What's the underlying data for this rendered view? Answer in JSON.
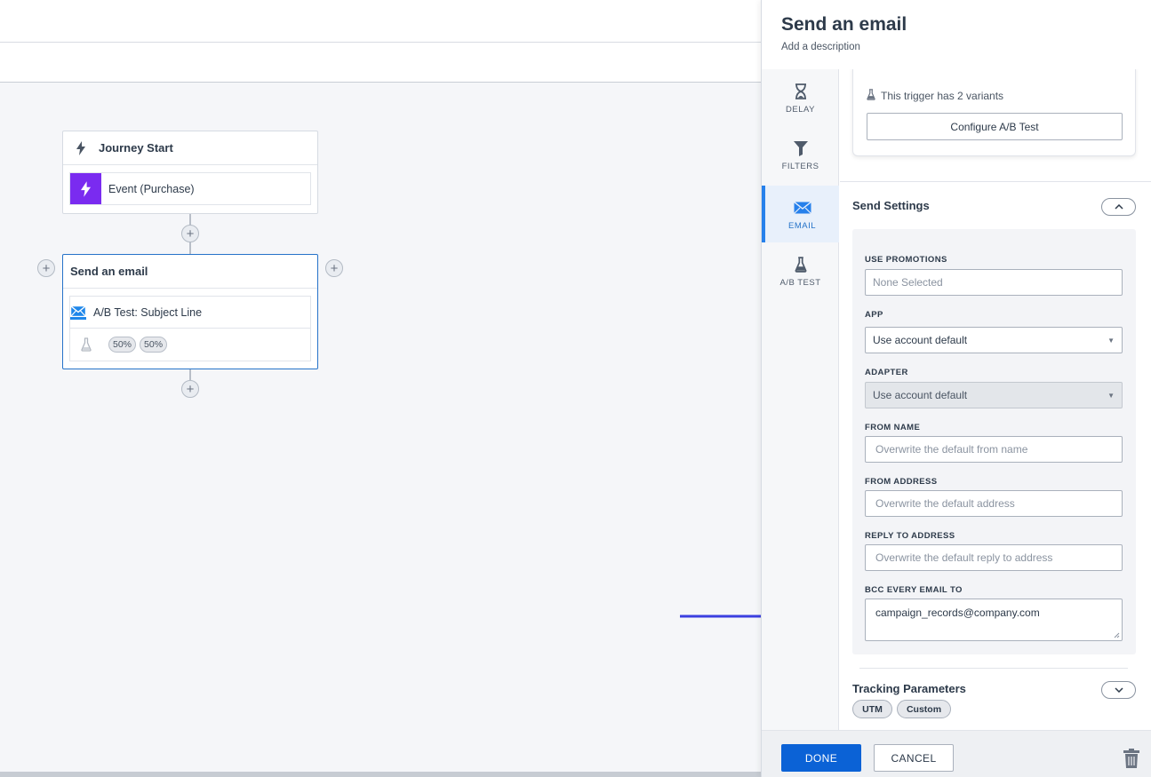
{
  "canvas": {
    "journey_start": {
      "title": "Journey Start",
      "event_label": "Event (Purchase)"
    },
    "email_node": {
      "title": "Send an email",
      "step_label": "A/B Test: Subject Line",
      "splits": [
        "50%",
        "50%"
      ]
    }
  },
  "panel": {
    "title": "Send an email",
    "description": "Add a description",
    "nav": [
      {
        "label": "DELAY",
        "icon": "hourglass-icon"
      },
      {
        "label": "FILTERS",
        "icon": "funnel-icon"
      },
      {
        "label": "EMAIL",
        "icon": "envelope-icon"
      },
      {
        "label": "A/B TEST",
        "icon": "flask-icon"
      }
    ],
    "ab_card": {
      "variants_text": "This trigger has 2 variants",
      "configure_label": "Configure A/B Test"
    },
    "send_settings": {
      "title": "Send Settings",
      "fields": {
        "use_promotions": {
          "label": "USE PROMOTIONS",
          "placeholder": "None Selected"
        },
        "app": {
          "label": "APP",
          "value": "Use account default"
        },
        "adapter": {
          "label": "ADAPTER",
          "value": "Use account default"
        },
        "from_name": {
          "label": "FROM NAME",
          "placeholder": "Overwrite the default from name"
        },
        "from_address": {
          "label": "FROM ADDRESS",
          "placeholder": "Overwrite the default address"
        },
        "reply_to": {
          "label": "REPLY TO ADDRESS",
          "placeholder": "Overwrite the default reply to address"
        },
        "bcc": {
          "label": "BCC EVERY EMAIL TO",
          "value": "campaign_records@company.com"
        }
      }
    },
    "tracking": {
      "title": "Tracking Parameters",
      "tags": [
        "UTM",
        "Custom"
      ]
    },
    "footer": {
      "done_label": "DONE",
      "cancel_label": "CANCEL"
    }
  },
  "colors": {
    "primary": "#0b62d6",
    "accent_blue": "#1f87ea",
    "event_purple": "#7a2bf0",
    "annotation_arrow": "#3b3fe0"
  }
}
